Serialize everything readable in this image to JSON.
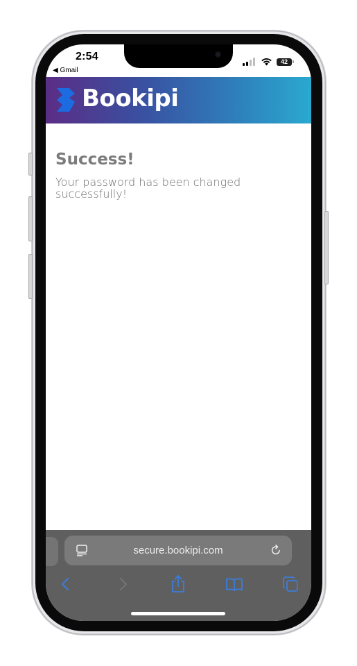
{
  "status_bar": {
    "time": "2:54",
    "back_app": "◀ Gmail",
    "battery": "42"
  },
  "header": {
    "logo_text": "Bookipi",
    "colors": {
      "gradient_start": "#5b2d86",
      "gradient_end": "#2aa9cf",
      "mark": "#1c6be0"
    }
  },
  "main": {
    "title": "Success!",
    "message": "Your password has been changed successfully!"
  },
  "browser": {
    "url": "secure.bookipi.com",
    "icons": [
      "page-menu-icon",
      "reload-icon",
      "back-icon",
      "forward-icon",
      "share-icon",
      "bookmarks-icon",
      "tabs-icon"
    ],
    "accent": "#3b7ddb"
  }
}
